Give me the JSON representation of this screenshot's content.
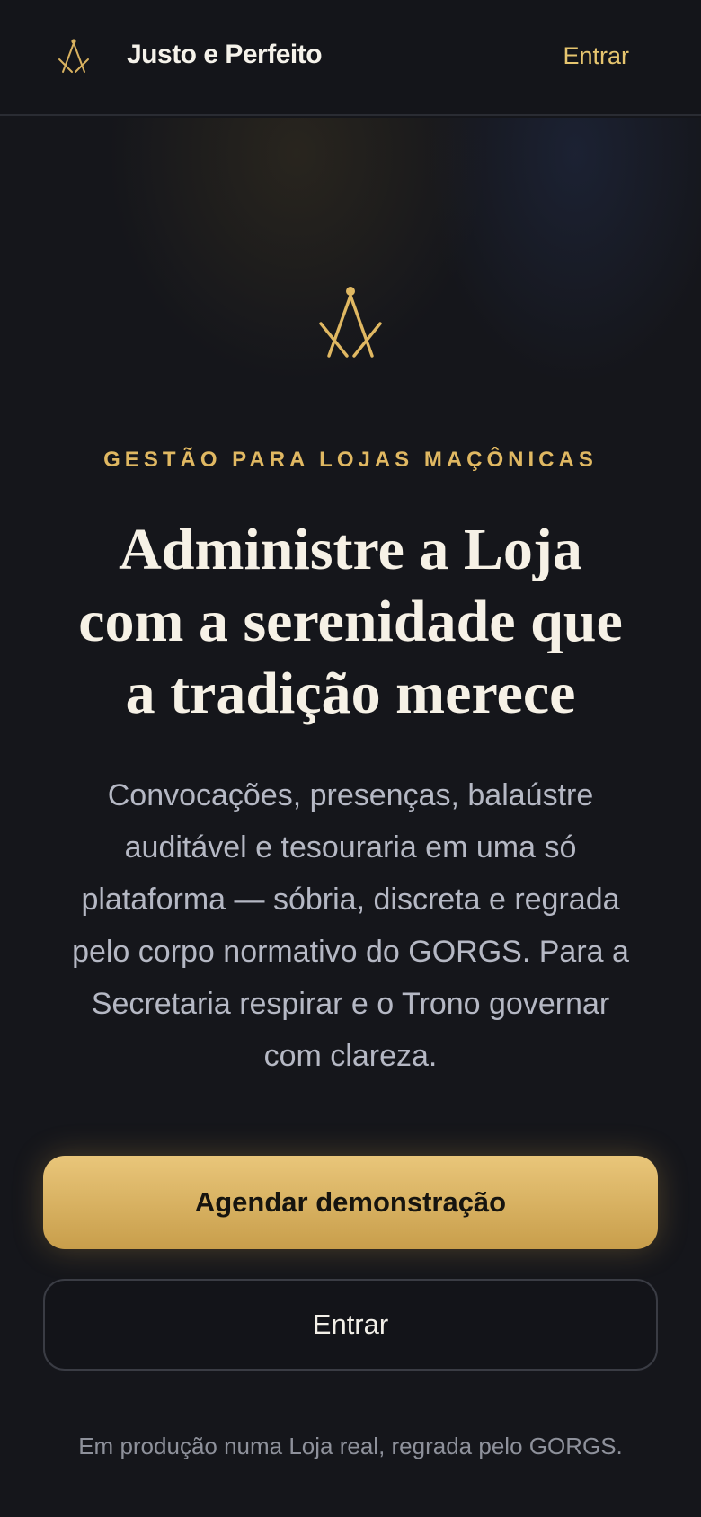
{
  "header": {
    "brand_name": "Justo e Perfeito",
    "login_label": "Entrar"
  },
  "hero": {
    "eyebrow": "GESTÃO PARA LOJAS MAÇÔNICAS",
    "headline_lines": [
      "Administre a Loja",
      "com a serenidade que",
      "a tradição merece"
    ],
    "description_lines": [
      "Convocações, presenças, balaústre",
      "auditável e tesouraria em uma só",
      "plataforma — sóbria, discreta e regrada",
      "pelo corpo normativo do GORGS. Para a",
      "Secretaria respirar e o Trono governar",
      "com clareza."
    ],
    "primary_cta": "Agendar demonstração",
    "secondary_cta": "Entrar",
    "footnote": "Em produção numa Loja real, regrada pelo GORGS."
  },
  "icons": {
    "brand": "compass-icon",
    "emblem": "compass-icon"
  },
  "colors": {
    "accent_gold": "#e0b862",
    "background": "#15161b",
    "button_gradient_top": "#e9c67a",
    "button_gradient_bottom": "#c89e4b"
  }
}
